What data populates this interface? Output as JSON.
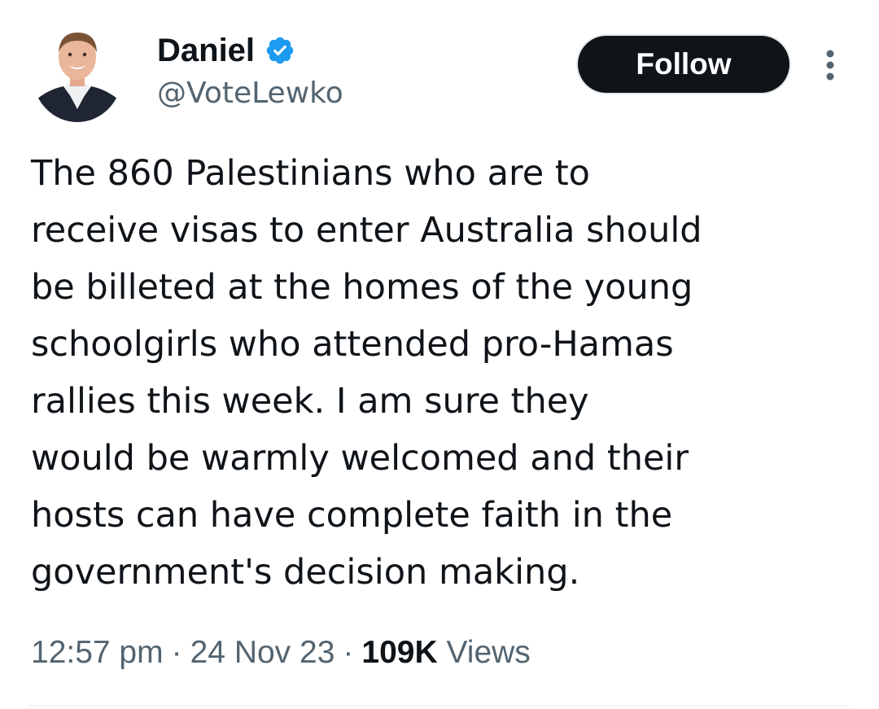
{
  "author": {
    "display_name": "Daniel",
    "handle": "@VoteLewko",
    "verified": true,
    "avatar_icon": "profile-photo",
    "verified_icon": "verified-badge-icon"
  },
  "actions": {
    "follow_label": "Follow",
    "more_icon": "more-options-icon"
  },
  "tweet": {
    "lines": [
      "The 860 Palestinians who are to",
      "receive visas to enter Australia should",
      "be billeted at the homes of the young",
      "schoolgirls who attended pro-Hamas",
      "rallies this week. I am sure they",
      "would be warmly welcomed and their",
      "hosts can have complete faith in the",
      "government's decision making."
    ]
  },
  "meta": {
    "time": "12:57 pm",
    "separator": "·",
    "date": "24 Nov 23",
    "views_count": "109K",
    "views_label": "Views"
  },
  "colors": {
    "text_primary": "#0f1419",
    "text_secondary": "#536471",
    "verified_blue": "#1d9bf0",
    "button_bg": "#0f1419",
    "button_text": "#ffffff"
  }
}
